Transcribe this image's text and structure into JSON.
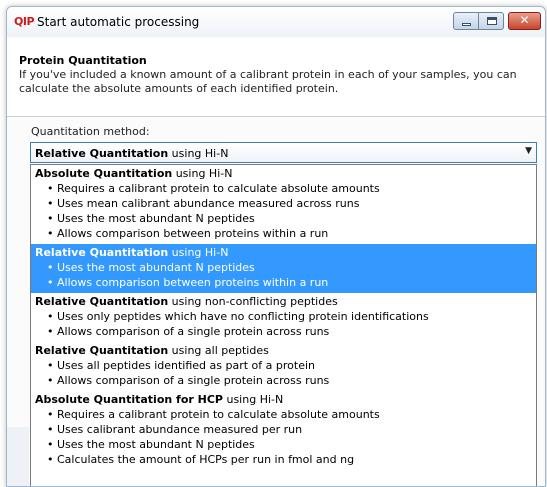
{
  "window": {
    "app_icon_text": "QIP",
    "title": "Start automatic processing",
    "controls": {
      "minimize": "minimize",
      "maximize": "maximize",
      "close": "✕"
    }
  },
  "section": {
    "title": "Protein Quantitation",
    "description": "If you've included a known amount of a calibrant protein in each of your samples, you can calculate the absolute amounts of each identified protein."
  },
  "method": {
    "label": "Quantitation method:",
    "selected_bold": "Relative Quantitation",
    "selected_rest": " using Hi-N"
  },
  "options": [
    {
      "bold": "Absolute Quantitation",
      "rest": " using Hi-N",
      "selected": false,
      "bullets": [
        "Requires a calibrant protein to calculate absolute amounts",
        "Uses mean calibrant abundance measured across runs",
        "Uses the most abundant N peptides",
        "Allows comparison between proteins within a run"
      ]
    },
    {
      "bold": "Relative Quantitation",
      "rest": " using Hi-N",
      "selected": true,
      "bullets": [
        "Uses the most abundant N peptides",
        "Allows comparison between proteins within a run"
      ]
    },
    {
      "bold": "Relative Quantitation",
      "rest": " using non-conflicting peptides",
      "selected": false,
      "bullets": [
        "Uses only peptides which have no conflicting protein identifications",
        "Allows comparison of a single protein across runs"
      ]
    },
    {
      "bold": "Relative Quantitation",
      "rest": " using all peptides",
      "selected": false,
      "bullets": [
        "Uses all peptides identified as part of a protein",
        "Allows comparison of a single protein across runs"
      ]
    },
    {
      "bold": "Absolute Quantitation for HCP",
      "rest": " using Hi-N",
      "selected": false,
      "bullets": [
        "Requires a calibrant protein to calculate absolute amounts",
        "Uses calibrant abundance measured per run",
        "Uses the most abundant N peptides",
        "Calculates the amount of HCPs per run in fmol and ng"
      ]
    }
  ]
}
